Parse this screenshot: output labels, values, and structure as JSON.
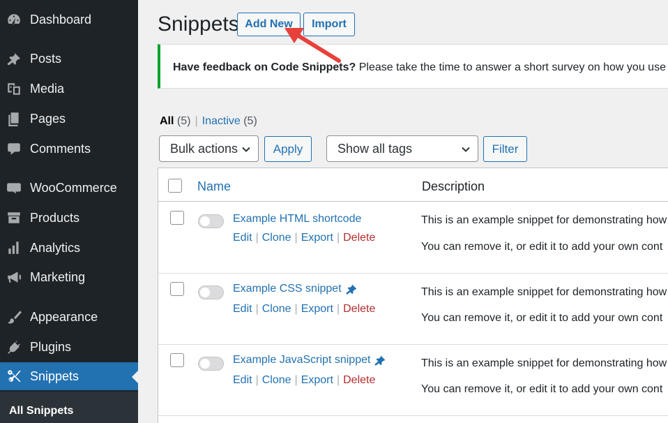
{
  "sidebar": {
    "items": [
      {
        "label": "Dashboard",
        "icon": "dashboard-icon"
      },
      {
        "label": "Posts",
        "icon": "pin-icon"
      },
      {
        "label": "Media",
        "icon": "media-icon"
      },
      {
        "label": "Pages",
        "icon": "pages-icon"
      },
      {
        "label": "Comments",
        "icon": "comment-icon"
      },
      {
        "label": "WooCommerce",
        "icon": "woo-icon"
      },
      {
        "label": "Products",
        "icon": "archive-icon"
      },
      {
        "label": "Analytics",
        "icon": "bar-chart-icon"
      },
      {
        "label": "Marketing",
        "icon": "megaphone-icon"
      },
      {
        "label": "Appearance",
        "icon": "brush-icon"
      },
      {
        "label": "Plugins",
        "icon": "plug-icon"
      },
      {
        "label": "Snippets",
        "icon": "scissors-icon",
        "current": true
      }
    ],
    "submenu": {
      "label": "All Snippets"
    }
  },
  "header": {
    "title": "Snippets",
    "add_new": "Add New",
    "import": "Import"
  },
  "notice": {
    "bold": "Have feedback on Code Snippets?",
    "text": " Please take the time to answer a short survey on how you use th"
  },
  "views": {
    "all_label": "All",
    "all_count": "(5)",
    "separator": "|",
    "inactive_label": "Inactive",
    "inactive_count": "(5)"
  },
  "filters": {
    "bulk_actions": "Bulk actions",
    "apply": "Apply",
    "tags": "Show all tags",
    "filter": "Filter"
  },
  "table": {
    "col_name": "Name",
    "col_description": "Description",
    "rows": [
      {
        "name": "Example HTML shortcode",
        "pinned": false,
        "desc1": "This is an example snippet for demonstrating how",
        "desc2": "You can remove it, or edit it to add your own cont"
      },
      {
        "name": "Example CSS snippet",
        "pinned": true,
        "desc1": "This is an example snippet for demonstrating how",
        "desc2": "You can remove it, or edit it to add your own cont"
      },
      {
        "name": "Example JavaScript snippet",
        "pinned": true,
        "desc1": "This is an example snippet for demonstrating how",
        "desc2": "You can remove it, or edit it to add your own cont"
      }
    ],
    "actions": {
      "edit": "Edit",
      "clone": "Clone",
      "export": "Export",
      "delete": "Delete",
      "bar": "|"
    }
  },
  "colors": {
    "sidebar_bg": "#1d2327",
    "accent": "#2271b1",
    "notice_border": "#00a32a",
    "delete": "#b32d2e",
    "arrow": "#e8403a"
  }
}
